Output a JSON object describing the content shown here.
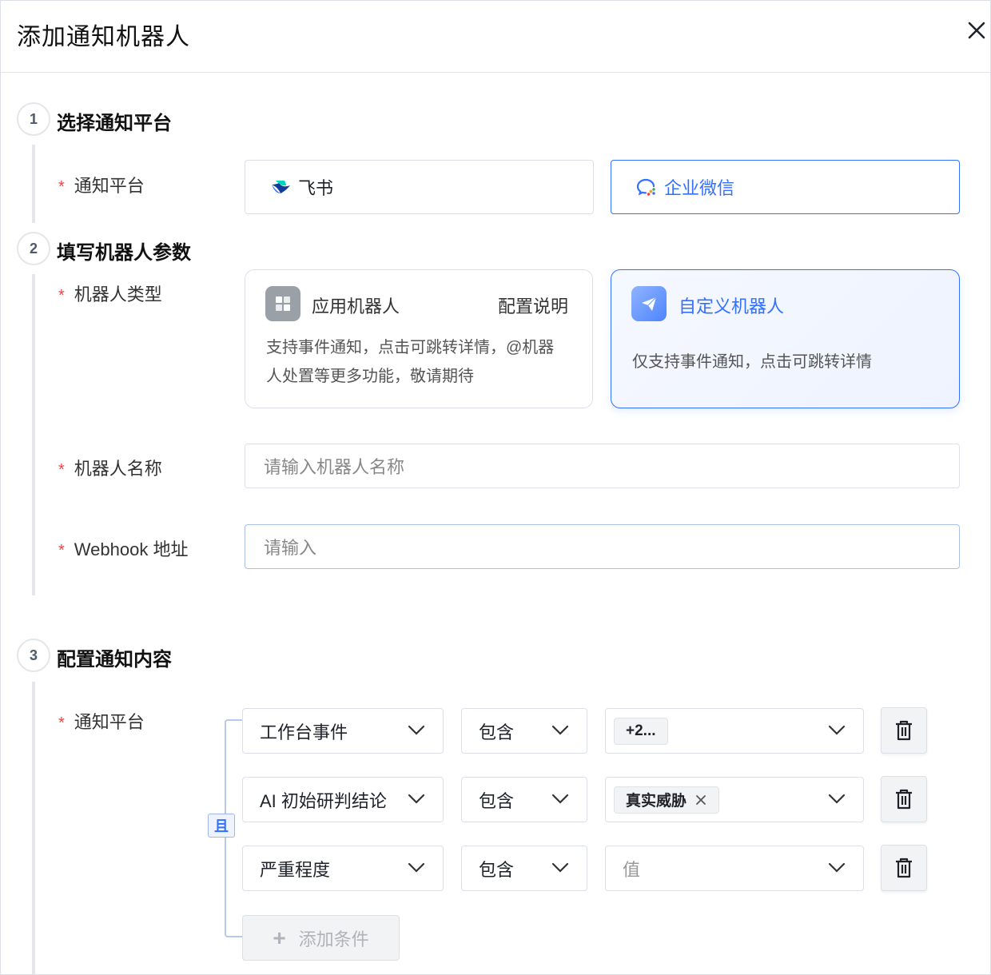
{
  "dialog": {
    "title": "添加通知机器人"
  },
  "steps": [
    {
      "num": "1",
      "title": "选择通知平台"
    },
    {
      "num": "2",
      "title": "填写机器人参数"
    },
    {
      "num": "3",
      "title": "配置通知内容"
    }
  ],
  "step1": {
    "label": "通知平台",
    "platforms": [
      {
        "label": "飞书",
        "icon": "feishu-icon",
        "selected": false
      },
      {
        "label": "企业微信",
        "icon": "wecom-icon",
        "selected": true
      }
    ]
  },
  "step2": {
    "type_label": "机器人类型",
    "types": [
      {
        "name": "应用机器人",
        "link": "配置说明",
        "desc": "支持事件通知，点击可跳转详情，@机器人处置等更多功能，敬请期待",
        "icon": "app-grid-icon",
        "selected": false
      },
      {
        "name": "自定义机器人",
        "desc": "仅支持事件通知，点击可跳转详情",
        "icon": "paper-plane-icon",
        "selected": true
      }
    ],
    "name_label": "机器人名称",
    "name_placeholder": "请输入机器人名称",
    "webhook_label": "Webhook 地址",
    "webhook_placeholder": "请输入"
  },
  "step3": {
    "label": "通知平台",
    "logic": "且",
    "conditions": [
      {
        "field": "工作台事件",
        "operator": "包含",
        "value_tag": "+2...",
        "value_placeholder": ""
      },
      {
        "field": "AI 初始研判结论",
        "operator": "包含",
        "value_tag": "真实威胁",
        "value_placeholder": ""
      },
      {
        "field": "严重程度",
        "operator": "包含",
        "value_tag": "",
        "value_placeholder": "值"
      }
    ],
    "add_label": "添加条件"
  },
  "colors": {
    "accent": "#3370ff",
    "required": "#f53f3f",
    "border": "#dcdfe6"
  }
}
